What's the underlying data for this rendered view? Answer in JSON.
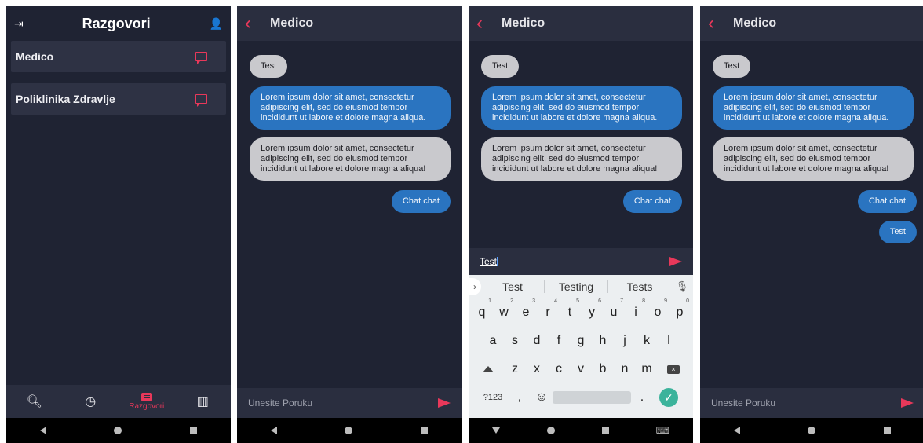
{
  "screen1": {
    "title": "Razgovori",
    "conversations": [
      {
        "name": "Medico"
      },
      {
        "name": "Poliklinika Zdravlje"
      }
    ],
    "tabs": {
      "active_label": "Razgovori"
    }
  },
  "chat": {
    "title": "Medico",
    "back_icon": "back-chevron-icon",
    "messages": [
      {
        "text": "Test",
        "dir": "received"
      },
      {
        "text": "Lorem ipsum dolor sit amet, consectetur adipiscing elit, sed do eiusmod tempor incididunt ut labore et dolore magna aliqua.",
        "dir": "sent"
      },
      {
        "text": "Lorem ipsum dolor sit amet, consectetur adipiscing elit, sed do eiusmod tempor incididunt ut labore et dolore magna aliqua!",
        "dir": "received"
      },
      {
        "text": "Chat chat",
        "dir": "sent"
      }
    ],
    "new_message": "Test",
    "input_placeholder": "Unesite Poruku"
  },
  "screen3": {
    "typing_value": "Test",
    "suggestions": [
      "Test",
      "Testing",
      "Tests"
    ],
    "row1": [
      "q",
      "w",
      "e",
      "r",
      "t",
      "y",
      "u",
      "i",
      "o",
      "p"
    ],
    "row1_nums": [
      "1",
      "2",
      "3",
      "4",
      "5",
      "6",
      "7",
      "8",
      "9",
      "0"
    ],
    "row2": [
      "a",
      "s",
      "d",
      "f",
      "g",
      "h",
      "j",
      "k",
      "l"
    ],
    "row3": [
      "z",
      "x",
      "c",
      "v",
      "b",
      "n",
      "m"
    ],
    "num_toggle": "?123",
    "comma": ",",
    "period": "."
  },
  "colors": {
    "accent": "#e8385a",
    "sent_bubble": "#2a74c0",
    "received_bubble": "#c9c9cd",
    "background": "#1f2333"
  }
}
